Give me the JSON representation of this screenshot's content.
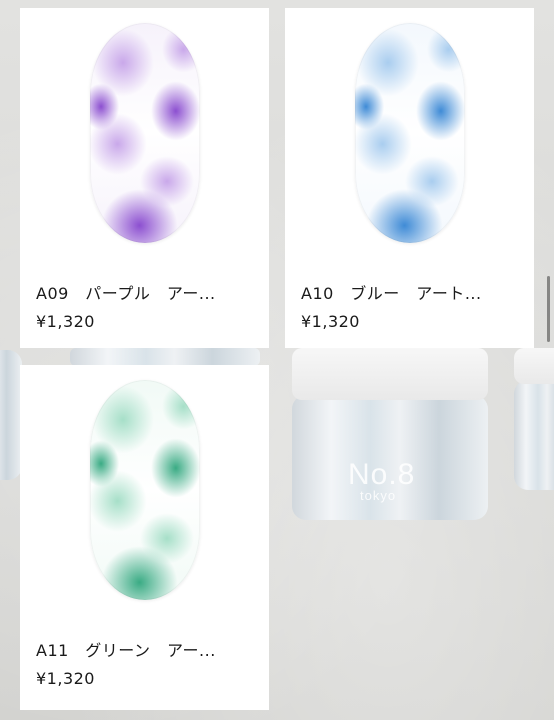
{
  "products": [
    {
      "code_name": "A09　パープル　アー...",
      "price": "¥1,320",
      "colors": [
        "#8c4fd0",
        "#c9a8ea",
        "#f6f2fb"
      ]
    },
    {
      "code_name": "A10　ブルー　アート...",
      "price": "¥1,320",
      "colors": [
        "#3f8bd6",
        "#a9cdef",
        "#f3f8fd"
      ]
    },
    {
      "code_name": "A11　グリーン　アー...",
      "price": "¥1,320",
      "colors": [
        "#3aab84",
        "#a6dfc8",
        "#f1faf6"
      ]
    }
  ],
  "background": {
    "jar_label": "No.8",
    "jar_sublabel": "tokyo"
  }
}
